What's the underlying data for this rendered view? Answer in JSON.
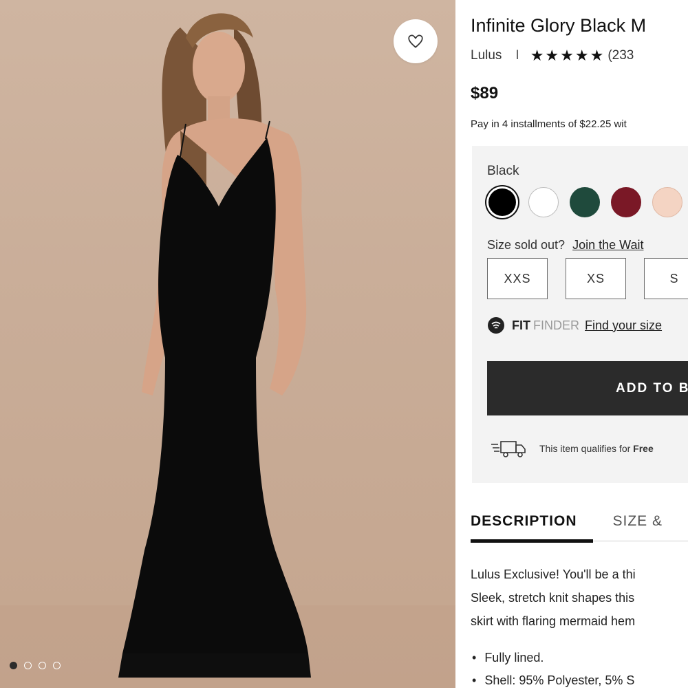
{
  "product": {
    "title": "Infinite Glory Black M",
    "brand": "Lulus",
    "separator": "I",
    "stars": "★★★★★",
    "rating": 5,
    "review_count": "(233",
    "price": "$89",
    "installments": "Pay in 4 installments of $22.25 wit"
  },
  "gallery": {
    "wishlist_icon": "heart-icon",
    "dots": 4,
    "active_dot": 0
  },
  "colors": {
    "selected_name": "Black",
    "swatches": [
      "#000000",
      "#ffffff",
      "#1f4a3c",
      "#7a1826",
      "#f4d4c3"
    ]
  },
  "sizes": {
    "sold_out_text": "Size sold out?",
    "waitlist_link": "Join the Wait",
    "options": [
      "XXS",
      "XS",
      "S"
    ]
  },
  "fit_finder": {
    "fit": "FIT",
    "finder": "FINDER",
    "link": "Find your size"
  },
  "cta": {
    "add_to_bag": "ADD TO B"
  },
  "shipping": {
    "text": "This item qualifies for",
    "bold": "Free"
  },
  "tabs": {
    "description": "DESCRIPTION",
    "size": "SIZE &"
  },
  "description": {
    "lines": [
      "Lulus Exclusive! You'll be a thi",
      "Sleek, stretch knit shapes this",
      "skirt with flaring mermaid hem"
    ],
    "bullets": [
      "Fully lined.",
      "Shell: 95% Polyester, 5% S"
    ]
  }
}
